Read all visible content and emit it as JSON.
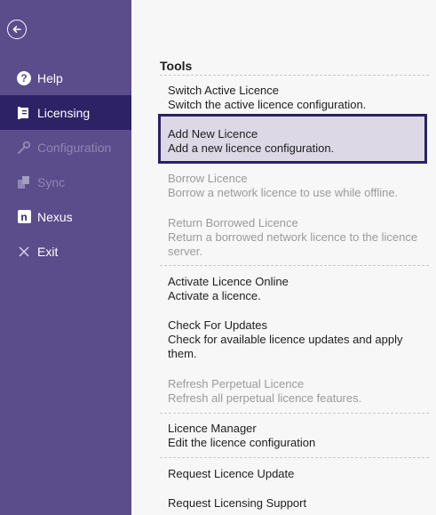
{
  "sidebar": {
    "back_label": "Back",
    "items": [
      {
        "label": "Help",
        "icon": "help-icon",
        "state": "normal"
      },
      {
        "label": "Licensing",
        "icon": "licensing-icon",
        "state": "active"
      },
      {
        "label": "Configuration",
        "icon": "wrench-icon",
        "state": "disabled"
      },
      {
        "label": "Sync",
        "icon": "sync-icon",
        "state": "disabled"
      },
      {
        "label": "Nexus",
        "icon": "nexus-icon",
        "state": "normal"
      },
      {
        "label": "Exit",
        "icon": "close-icon",
        "state": "normal"
      }
    ]
  },
  "main": {
    "section_title": "Tools",
    "items": [
      {
        "title": "Switch Active Licence",
        "desc": "Switch the active licence configuration.",
        "state": "normal"
      },
      {
        "title": "Add New Licence",
        "desc": "Add a new licence configuration.",
        "state": "selected"
      },
      {
        "title": "Borrow Licence",
        "desc": "Borrow a network licence to use while offline.",
        "state": "disabled"
      },
      {
        "title": "Return Borrowed Licence",
        "desc": "Return a borrowed network licence to the licence server.",
        "state": "disabled"
      },
      {
        "title": "Activate Licence Online",
        "desc": "Activate a licence.",
        "state": "normal"
      },
      {
        "title": "Check For Updates",
        "desc": "Check for available licence updates and apply them.",
        "state": "normal"
      },
      {
        "title": "Refresh Perpetual Licence",
        "desc": "Refresh all perpetual licence features.",
        "state": "disabled"
      },
      {
        "title": "Licence Manager",
        "desc": "Edit the licence configuration",
        "state": "normal"
      },
      {
        "title": "Request Licence Update",
        "desc": "",
        "state": "normal"
      },
      {
        "title": "Request Licensing Support",
        "desc": "",
        "state": "normal"
      }
    ]
  },
  "colors": {
    "sidebar_bg": "#5b4c8c",
    "sidebar_active": "#2e2266",
    "selected_bg": "#dcd8e6",
    "selected_border": "#2a2260"
  }
}
